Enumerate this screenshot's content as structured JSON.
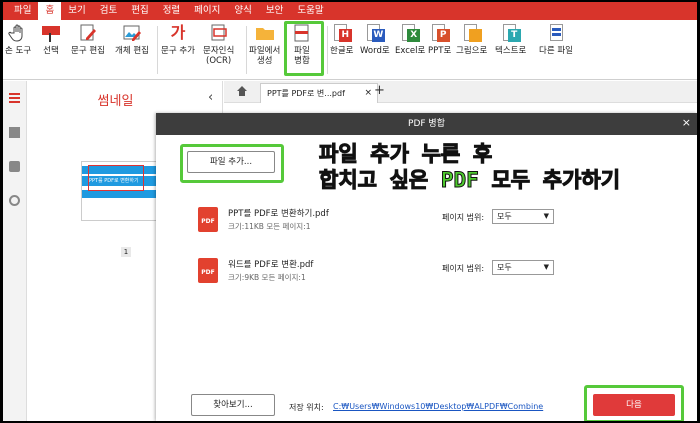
{
  "menu": {
    "items": [
      "파일",
      "홈",
      "보기",
      "검토",
      "편집",
      "정렬",
      "페이지",
      "양식",
      "보안",
      "도움말"
    ],
    "active_index": 1
  },
  "ribbon": {
    "tools": [
      {
        "label": "손 도구",
        "icon": "hand-icon"
      },
      {
        "label": "선택",
        "icon": "text-select-icon"
      },
      {
        "label": "문구 편집",
        "icon": "edit-text-icon"
      },
      {
        "label": "개체 편집",
        "icon": "edit-object-icon"
      },
      {
        "label": "문구 추가",
        "icon": "add-text-icon"
      },
      {
        "label": "문자인식\n(OCR)",
        "icon": "ocr-icon"
      },
      {
        "label": "파일에서\n생성",
        "icon": "folder-icon"
      },
      {
        "label": "파일\n병합",
        "icon": "merge-icon"
      },
      {
        "label": "한글로",
        "icon": "hwp-icon"
      },
      {
        "label": "Word로",
        "icon": "word-icon"
      },
      {
        "label": "Excel로",
        "icon": "excel-icon"
      },
      {
        "label": "PPT로",
        "icon": "ppt-icon"
      },
      {
        "label": "그림으로",
        "icon": "image-icon"
      },
      {
        "label": "텍스트로",
        "icon": "txt-icon"
      },
      {
        "label": "다른 파일",
        "icon": "other-file-icon"
      }
    ]
  },
  "thumbnails": {
    "title": "썸네일",
    "page_text": "PPT를 PDF로 변환하기",
    "page_number": "1"
  },
  "tabs": {
    "doc_tab": "PPT를 PDF로 변...pdf",
    "close": "×",
    "add": "+"
  },
  "dialog": {
    "title": "PDF 병합",
    "close": "×",
    "add_files_button": "파일 추가...",
    "annotation_line1": "파일 추가 누른 후",
    "annotation_line2": "합치고 싶은 PDF 모두 추가하기",
    "files": [
      {
        "name": "PPT를 PDF로 변환하기.pdf",
        "meta": "크기:11KB   모든 페이지:1",
        "range_label": "페이지 범위:",
        "range_value": "모두"
      },
      {
        "name": "워드를 PDF로 변환.pdf",
        "meta": "크기:9KB   모든 페이지:1",
        "range_label": "페이지 범위:",
        "range_value": "모두"
      }
    ],
    "pdf_icon_text": "PDF",
    "browse_button": "찾아보기...",
    "save_label": "저장 위치:",
    "save_path": "C:₩Users₩Windows10₩Desktop₩ALPDF₩Combine",
    "next_button": "다음"
  },
  "colors": {
    "brand_red": "#d8342b",
    "highlight_green": "#56c93a",
    "dialog_header": "#3d3d3d",
    "next_button": "#e03a3a"
  }
}
